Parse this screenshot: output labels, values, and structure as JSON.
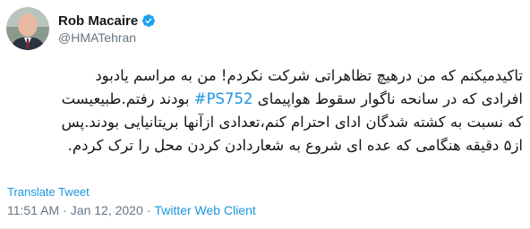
{
  "author": {
    "name": "Rob Macaire",
    "handle": "@HMATehran",
    "verified": true
  },
  "tweet": {
    "lines": [
      "تاکیدمیکنم که من درهیچ تظاهراتی شرکت نکردم! من به مراسم یادبود",
      "افرادی که در سانحه ناگوار سقوط هواپیمای ",
      " بودند رفتم.طبیعیست",
      "که نسبت به کشته شدگان ادای احترام کنم،تعدادی ازآنها بریتانیایی بودند.پس",
      "از۵ دقیقه هنگامی که عده ای شروع به شعاردادن کردن محل را ترک کردم."
    ],
    "hashtag": "#PS752"
  },
  "actions": {
    "translate_label": "Translate Tweet"
  },
  "meta": {
    "time": "11:51 AM",
    "separator": "·",
    "date": "Jan 12, 2020",
    "client": "Twitter Web Client"
  },
  "colors": {
    "link": "#1b95e0",
    "secondary_text": "#657786",
    "verified_badge": "#1da1f2"
  }
}
